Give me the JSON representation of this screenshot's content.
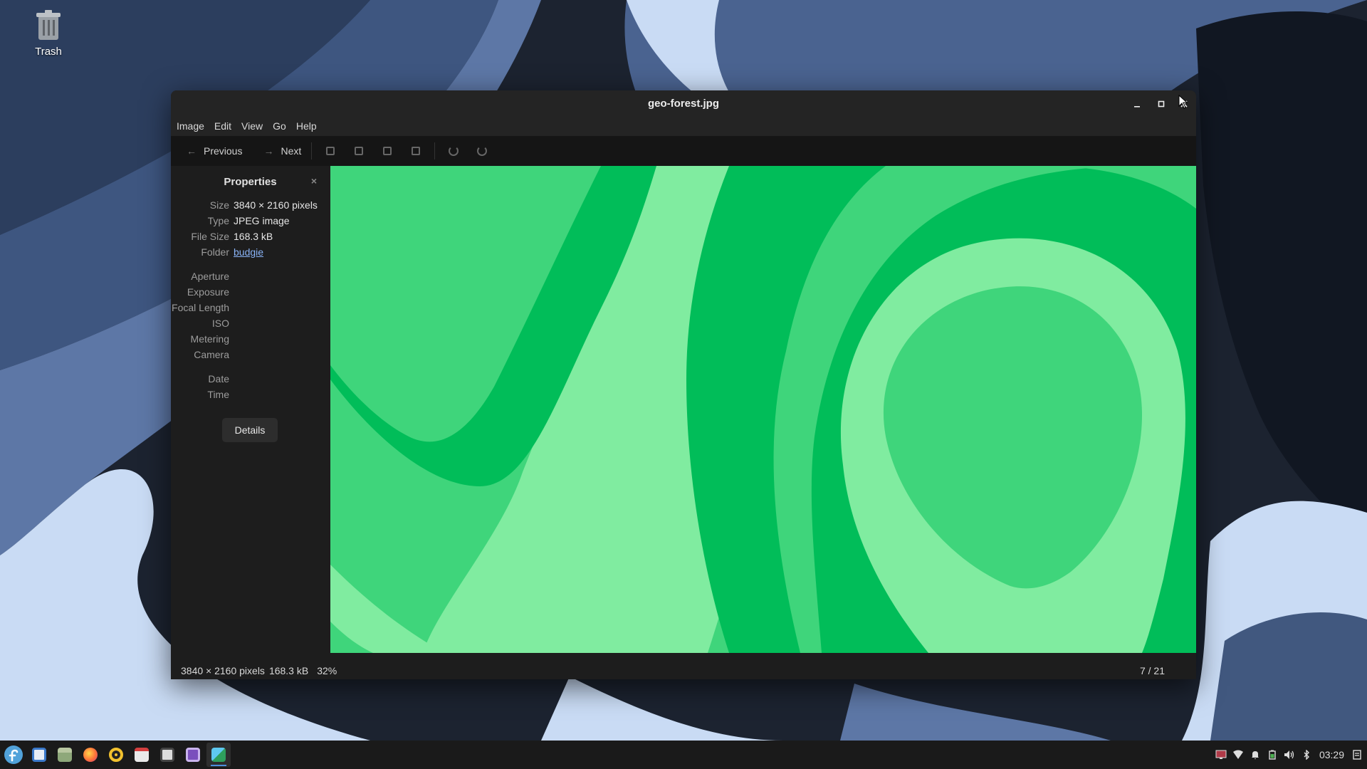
{
  "desktop": {
    "trash_label": "Trash"
  },
  "window": {
    "title": "geo-forest.jpg"
  },
  "menubar": {
    "items": [
      "Image",
      "Edit",
      "View",
      "Go",
      "Help"
    ]
  },
  "toolbar": {
    "previous_label": "Previous",
    "next_label": "Next"
  },
  "properties": {
    "heading": "Properties",
    "close_glyph": "×",
    "size_label": "Size",
    "size_value": "3840 × 2160 pixels",
    "type_label": "Type",
    "type_value": "JPEG image",
    "filesize_label": "File Size",
    "filesize_value": "168.3 kB",
    "folder_label": "Folder",
    "folder_value": "budgie",
    "exif_labels": [
      "Aperture",
      "Exposure",
      "Focal Length",
      "ISO",
      "Metering",
      "Camera"
    ],
    "date_label": "Date",
    "time_label": "Time",
    "details_button": "Details"
  },
  "statusbar": {
    "dimensions": "3840 × 2160 pixels",
    "filesize": "168.3 kB",
    "zoom": "32%",
    "position": "7 / 21"
  },
  "taskbar": {
    "clock": "03:29"
  },
  "colors": {
    "accent": "#4c8fdc",
    "image_green_dark": "#01bd59",
    "image_green_mid": "#3fd57b",
    "image_green_light": "#80eca0"
  }
}
